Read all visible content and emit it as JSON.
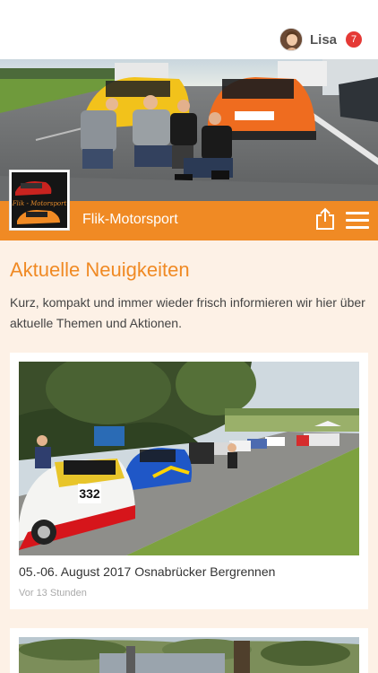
{
  "header": {
    "user_name": "Lisa",
    "notification_count": "7",
    "avatar_icon": "user-avatar"
  },
  "brand": {
    "name": "Flik-Motorsport",
    "logo_text": "Flik - Motorsport",
    "accent_color": "#f08a24",
    "share_icon": "share-icon",
    "menu_icon": "hamburger-menu-icon"
  },
  "news": {
    "title": "Aktuelle Neuigkeiten",
    "intro": "Kurz, kompakt und immer wieder frisch informieren wir hier über aktuelle Themen und Aktionen.",
    "items": [
      {
        "title": "05.-06. August 2017 Osnabrücker Bergrennen",
        "time": "Vor 13 Stunden",
        "car_number": "332"
      },
      {
        "title": "",
        "time": ""
      }
    ]
  }
}
